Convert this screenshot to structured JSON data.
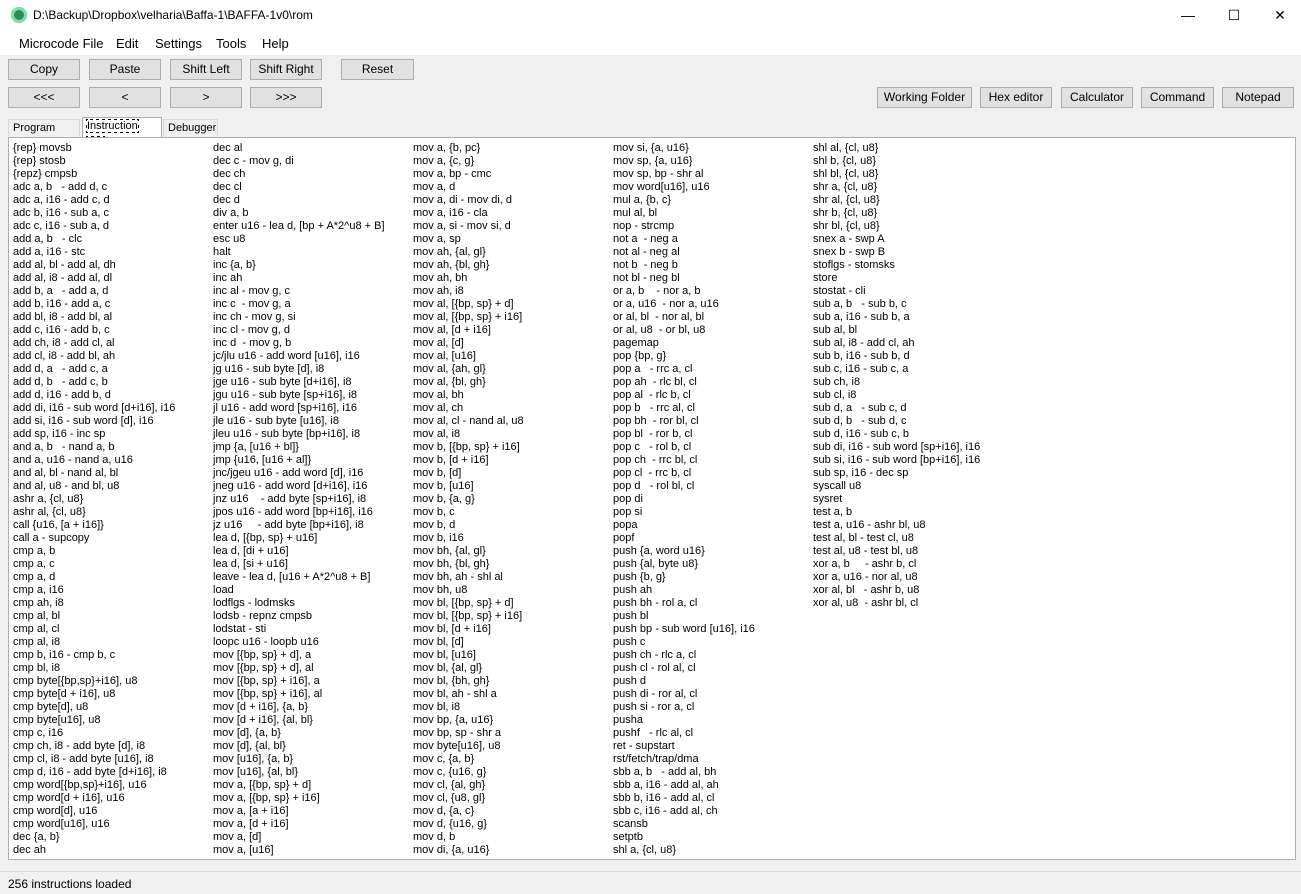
{
  "window": {
    "title": "D:\\Backup\\Dropbox\\velharia\\Baffa-1\\BAFFA-1v0\\rom"
  },
  "menu": [
    "Microcode File",
    "Edit",
    "Settings",
    "Tools",
    "Help"
  ],
  "toolbar1": {
    "copy": "Copy",
    "paste": "Paste",
    "shift_left": "Shift Left",
    "shift_right": "Shift Right",
    "reset": "Reset"
  },
  "toolbar2": {
    "first": "<<<",
    "prev": "<",
    "next": ">",
    "last": ">>>"
  },
  "tools": {
    "working_folder": "Working Folder",
    "hex_editor": "Hex editor",
    "calculator": "Calculator",
    "command": "Command",
    "notepad": "Notepad"
  },
  "tabs": [
    "Program data",
    "Instruction List",
    "Debugger"
  ],
  "columns": [
    [
      "{rep} movsb",
      "{rep} stosb",
      "{repz} cmpsb",
      "adc a, b   - add d, c",
      "adc a, i16 - add c, d",
      "adc b, i16 - sub a, c",
      "adc c, i16 - sub a, d",
      "add a, b   - clc",
      "add a, i16 - stc",
      "add al, bl - add al, dh",
      "add al, i8 - add al, dl",
      "add b, a   - add a, d",
      "add b, i16 - add a, c",
      "add bl, i8 - add bl, al",
      "add c, i16 - add b, c",
      "add ch, i8 - add cl, al",
      "add cl, i8 - add bl, ah",
      "add d, a   - add c, a",
      "add d, b   - add c, b",
      "add d, i16 - add b, d",
      "add di, i16 - sub word [d+i16], i16",
      "add si, i16 - sub word [d], i16",
      "add sp, i16 - inc sp",
      "and a, b   - nand a, b",
      "and a, u16 - nand a, u16",
      "and al, bl - nand al, bl",
      "and al, u8 - and bl, u8",
      "ashr a, {cl, u8}",
      "ashr al, {cl, u8}",
      "call {u16, [a + i16]}",
      "call a - supcopy",
      "cmp a, b",
      "cmp a, c",
      "cmp a, d",
      "cmp a, i16",
      "cmp ah, i8",
      "cmp al, bl",
      "cmp al, cl",
      "cmp al, i8",
      "cmp b, i16 - cmp b, c",
      "cmp bl, i8",
      "cmp byte[{bp,sp}+i16], u8",
      "cmp byte[d + i16], u8",
      "cmp byte[d], u8",
      "cmp byte[u16], u8",
      "cmp c, i16",
      "cmp ch, i8 - add byte [d], i8",
      "cmp cl, i8 - add byte [u16], i8",
      "cmp d, i16 - add byte [d+i16], i8",
      "cmp word[{bp,sp}+i16], u16",
      "cmp word[d + i16], u16",
      "cmp word[d], u16",
      "cmp word[u16], u16",
      "dec {a, b}",
      "dec ah"
    ],
    [
      "dec al",
      "dec c - mov g, di",
      "dec ch",
      "dec cl",
      "dec d",
      "div a, b",
      "enter u16 - lea d, [bp + A*2^u8 + B]",
      "esc u8",
      "halt",
      "inc {a, b}",
      "inc ah",
      "inc al - mov g, c",
      "inc c  - mov g, a",
      "inc ch - mov g, si",
      "inc cl - mov g, d",
      "inc d  - mov g, b",
      "jc/jlu u16 - add word [u16], i16",
      "jg u16 - sub byte [d], i8",
      "jge u16 - sub byte [d+i16], i8",
      "jgu u16 - sub byte [sp+i16], i8",
      "jl u16 - add word [sp+i16], i16",
      "jle u16 - sub byte [u16], i8",
      "jleu u16 - sub byte [bp+i16], i8",
      "jmp {a, [u16 + bl]}",
      "jmp {u16, [u16 + al]}",
      "jnc/jgeu u16 - add word [d], i16",
      "jneg u16 - add word [d+i16], i16",
      "jnz u16    - add byte [sp+i16], i8",
      "jpos u16 - add word [bp+i16], i16",
      "jz u16     - add byte [bp+i16], i8",
      "lea d, [{bp, sp} + u16]",
      "lea d, [di + u16]",
      "lea d, [si + u16]",
      "leave - lea d, [u16 + A*2^u8 + B]",
      "load",
      "lodflgs - lodmsks",
      "lodsb - repnz cmpsb",
      "lodstat - sti",
      "loopc u16 - loopb u16",
      "mov [{bp, sp} + d], a",
      "mov [{bp, sp} + d], al",
      "mov [{bp, sp} + i16], a",
      "mov [{bp, sp} + i16], al",
      "mov [d + i16], {a, b}",
      "mov [d + i16], {al, bl}",
      "mov [d], {a, b}",
      "mov [d], {al, bl}",
      "mov [u16], {a, b}",
      "mov [u16], {al, bl}",
      "mov a, [{bp, sp} + d]",
      "mov a, [{bp, sp} + i16]",
      "mov a, [a + i16]",
      "mov a, [d + i16]",
      "mov a, [d]",
      "mov a, [u16]"
    ],
    [
      "mov a, {b, pc}",
      "mov a, {c, g}",
      "mov a, bp - cmc",
      "mov a, d",
      "mov a, di - mov di, d",
      "mov a, i16 - cla",
      "mov a, si - mov si, d",
      "mov a, sp",
      "mov ah, {al, gl}",
      "mov ah, {bl, gh}",
      "mov ah, bh",
      "mov ah, i8",
      "mov al, [{bp, sp} + d]",
      "mov al, [{bp, sp} + i16]",
      "mov al, [d + i16]",
      "mov al, [d]",
      "mov al, [u16]",
      "mov al, {ah, gl}",
      "mov al, {bl, gh}",
      "mov al, bh",
      "mov al, ch",
      "mov al, cl - nand al, u8",
      "mov al, i8",
      "mov b, [{bp, sp} + i16]",
      "mov b, [d + i16]",
      "mov b, [d]",
      "mov b, [u16]",
      "mov b, {a, g}",
      "mov b, c",
      "mov b, d",
      "mov b, i16",
      "mov bh, {al, gl}",
      "mov bh, {bl, gh}",
      "mov bh, ah - shl al",
      "mov bh, u8",
      "mov bl, [{bp, sp} + d]",
      "mov bl, [{bp, sp} + i16]",
      "mov bl, [d + i16]",
      "mov bl, [d]",
      "mov bl, [u16]",
      "mov bl, {al, gl}",
      "mov bl, {bh, gh}",
      "mov bl, ah - shl a",
      "mov bl, i8",
      "mov bp, {a, u16}",
      "mov bp, sp - shr a",
      "mov byte[u16], u8",
      "mov c, {a, b}",
      "mov c, {u16, g}",
      "mov cl, {al, gh}",
      "mov cl, {u8, gl}",
      "mov d, {a, c}",
      "mov d, {u16, g}",
      "mov d, b",
      "mov di, {a, u16}"
    ],
    [
      "mov si, {a, u16}",
      "mov sp, {a, u16}",
      "mov sp, bp - shr al",
      "mov word[u16], u16",
      "mul a, {b, c}",
      "mul al, bl",
      "nop - strcmp",
      "not a  - neg a",
      "not al - neg al",
      "not b  - neg b",
      "not bl - neg bl",
      "or a, b    - nor a, b",
      "or a, u16  - nor a, u16",
      "or al, bl  - nor al, bl",
      "or al, u8  - or bl, u8",
      "pagemap",
      "pop {bp, g}",
      "pop a   - rrc a, cl",
      "pop ah  - rlc bl, cl",
      "pop al  - rlc b, cl",
      "pop b   - rrc al, cl",
      "pop bh  - ror bl, cl",
      "pop bl  - ror b, cl",
      "pop c   - rol b, cl",
      "pop ch  - rrc bl, cl",
      "pop cl  - rrc b, cl",
      "pop d   - rol bl, cl",
      "pop di",
      "pop si",
      "popa",
      "popf",
      "push {a, word u16}",
      "push {al, byte u8}",
      "push {b, g}",
      "push ah",
      "push bh - rol a, cl",
      "push bl",
      "push bp - sub word [u16], i16",
      "push c",
      "push ch - rlc a, cl",
      "push cl - rol al, cl",
      "push d",
      "push di - ror al, cl",
      "push si - ror a, cl",
      "pusha",
      "pushf   - rlc al, cl",
      "ret - supstart",
      "rst/fetch/trap/dma",
      "sbb a, b   - add al, bh",
      "sbb a, i16 - add al, ah",
      "sbb b, i16 - add al, cl",
      "sbb c, i16 - add al, ch",
      "scansb",
      "setptb",
      "shl a, {cl, u8}"
    ],
    [
      "shl al, {cl, u8}",
      "shl b, {cl, u8}",
      "shl bl, {cl, u8}",
      "shr a, {cl, u8}",
      "shr al, {cl, u8}",
      "shr b, {cl, u8}",
      "shr bl, {cl, u8}",
      "snex a - swp A",
      "snex b - swp B",
      "stoflgs - stomsks",
      "store",
      "stostat - cli",
      "sub a, b   - sub b, c",
      "sub a, i16 - sub b, a",
      "sub al, bl",
      "sub al, i8 - add cl, ah",
      "sub b, i16 - sub b, d",
      "sub c, i16 - sub c, a",
      "sub ch, i8",
      "sub cl, i8",
      "sub d, a   - sub c, d",
      "sub d, b   - sub d, c",
      "sub d, i16 - sub c, b",
      "sub di, i16 - sub word [sp+i16], i16",
      "sub si, i16 - sub word [bp+i16], i16",
      "sub sp, i16 - dec sp",
      "syscall u8",
      "sysret",
      "test a, b",
      "test a, u16 - ashr bl, u8",
      "test al, bl - test cl, u8",
      "test al, u8 - test bl, u8",
      "xor a, b     - ashr b, cl",
      "xor a, u16 - nor al, u8",
      "xor al, bl   - ashr b, u8",
      "xor al, u8  - ashr bl, cl"
    ]
  ],
  "status": "256 instructions loaded"
}
